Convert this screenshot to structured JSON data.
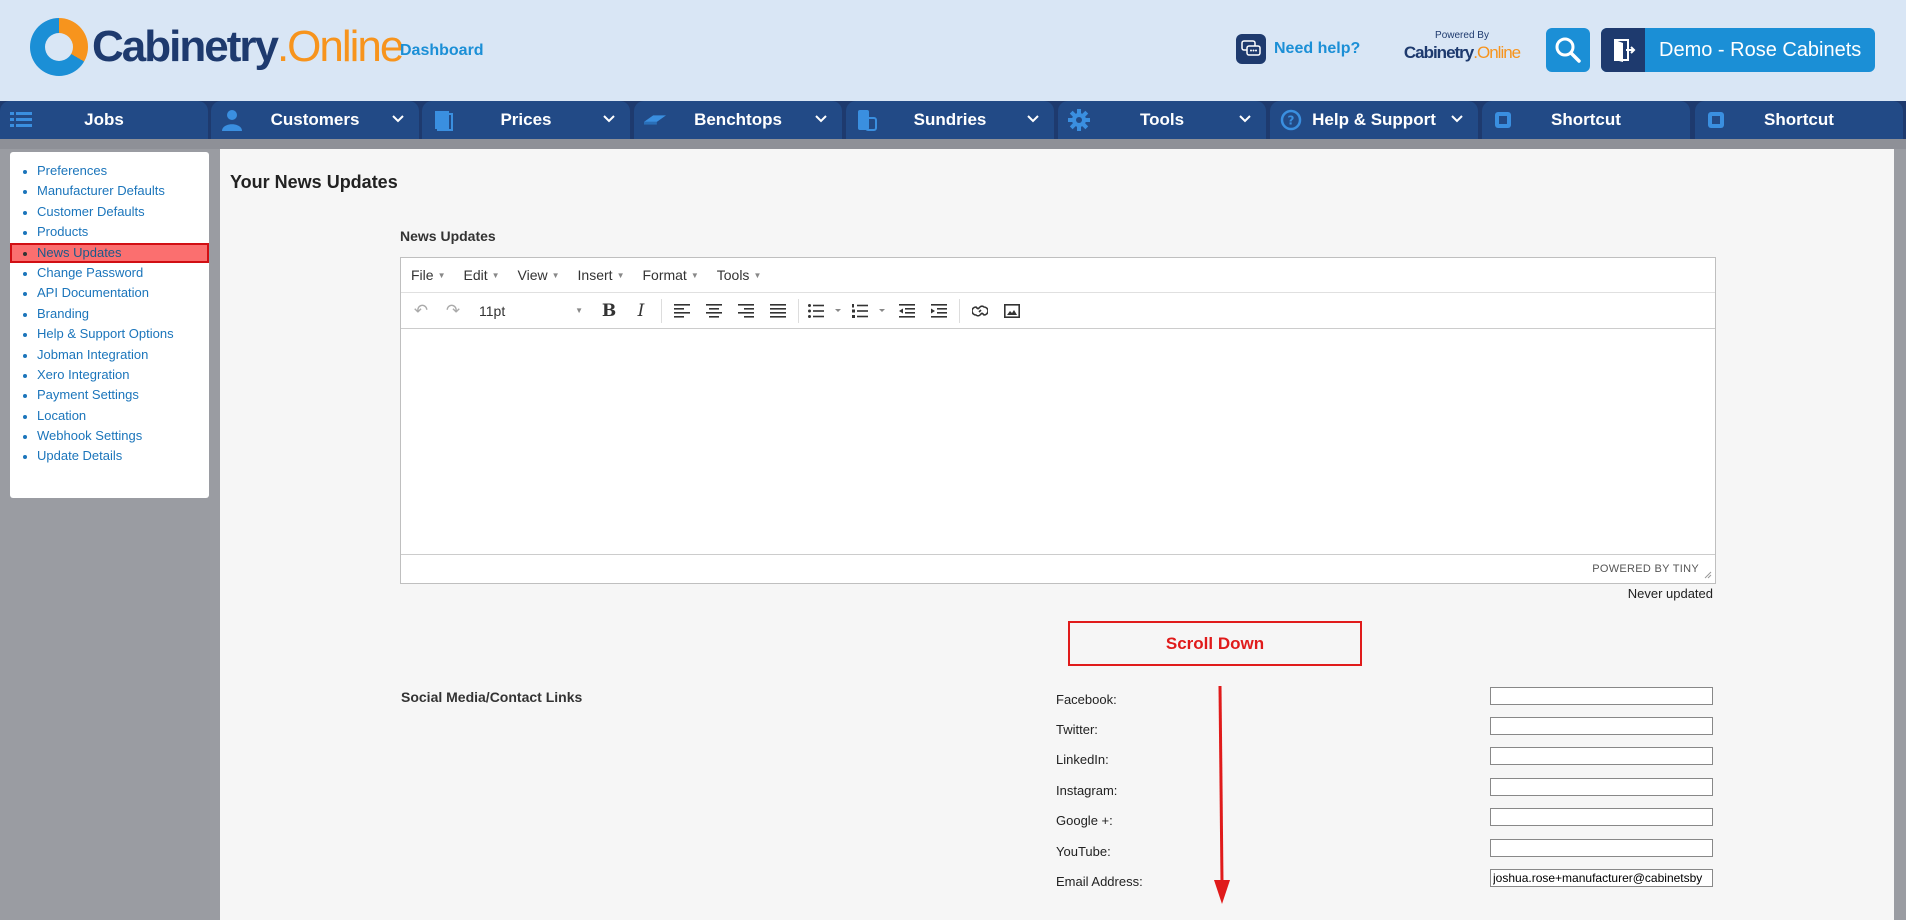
{
  "header": {
    "logo": {
      "part1": "Cabinetry",
      "part2": ".Online"
    },
    "dashboard_link": "Dashboard",
    "need_help": "Need help?",
    "powered_by": {
      "label": "Powered By",
      "part1": "Cabinetry",
      "part2": ".Online"
    },
    "user_button": "Demo - Rose Cabinets"
  },
  "nav": {
    "tabs": [
      {
        "label": "Jobs",
        "icon": "list-icon",
        "dropdown": false
      },
      {
        "label": "Customers",
        "icon": "person-icon",
        "dropdown": true
      },
      {
        "label": "Prices",
        "icon": "price-book-icon",
        "dropdown": true
      },
      {
        "label": "Benchtops",
        "icon": "benchtop-icon",
        "dropdown": true
      },
      {
        "label": "Sundries",
        "icon": "sundries-icon",
        "dropdown": true
      },
      {
        "label": "Tools",
        "icon": "gear-icon",
        "dropdown": true
      },
      {
        "label": "Help & Support",
        "icon": "help-icon",
        "dropdown": true
      },
      {
        "label": "Shortcut",
        "icon": "shortcut-icon",
        "dropdown": false
      },
      {
        "label": "Shortcut",
        "icon": "shortcut-icon",
        "dropdown": false
      }
    ]
  },
  "sidebar": {
    "items": [
      {
        "label": "Preferences"
      },
      {
        "label": "Manufacturer Defaults"
      },
      {
        "label": "Customer Defaults"
      },
      {
        "label": "Products"
      },
      {
        "label": "News Updates",
        "active": true
      },
      {
        "label": "Change Password"
      },
      {
        "label": "API Documentation"
      },
      {
        "label": "Branding"
      },
      {
        "label": "Help & Support Options"
      },
      {
        "label": "Jobman Integration"
      },
      {
        "label": "Xero Integration"
      },
      {
        "label": "Payment Settings"
      },
      {
        "label": "Location"
      },
      {
        "label": "Webhook Settings"
      },
      {
        "label": "Update Details"
      }
    ]
  },
  "main": {
    "title": "Your News Updates",
    "news_label": "News Updates",
    "editor": {
      "menus": [
        "File",
        "Edit",
        "View",
        "Insert",
        "Format",
        "Tools"
      ],
      "font_size": "11pt",
      "powered_by": "POWERED BY TINY"
    },
    "last_updated": "Never updated",
    "annotation": "Scroll Down",
    "social_label": "Social Media/Contact Links",
    "fields": [
      {
        "label": "Facebook:",
        "value": ""
      },
      {
        "label": "Twitter:",
        "value": ""
      },
      {
        "label": "LinkedIn:",
        "value": ""
      },
      {
        "label": "Instagram:",
        "value": ""
      },
      {
        "label": "Google +:",
        "value": ""
      },
      {
        "label": "YouTube:",
        "value": ""
      },
      {
        "label": "Email Address:",
        "value": "joshua.rose+manufacturer@cabinetsby"
      }
    ]
  },
  "colors": {
    "brand_navy": "#1e3a6e",
    "brand_blue": "#1b8fd6",
    "brand_orange": "#f7941d",
    "annotation_red": "#e01b1b",
    "active_highlight": "#fb6f6f"
  }
}
